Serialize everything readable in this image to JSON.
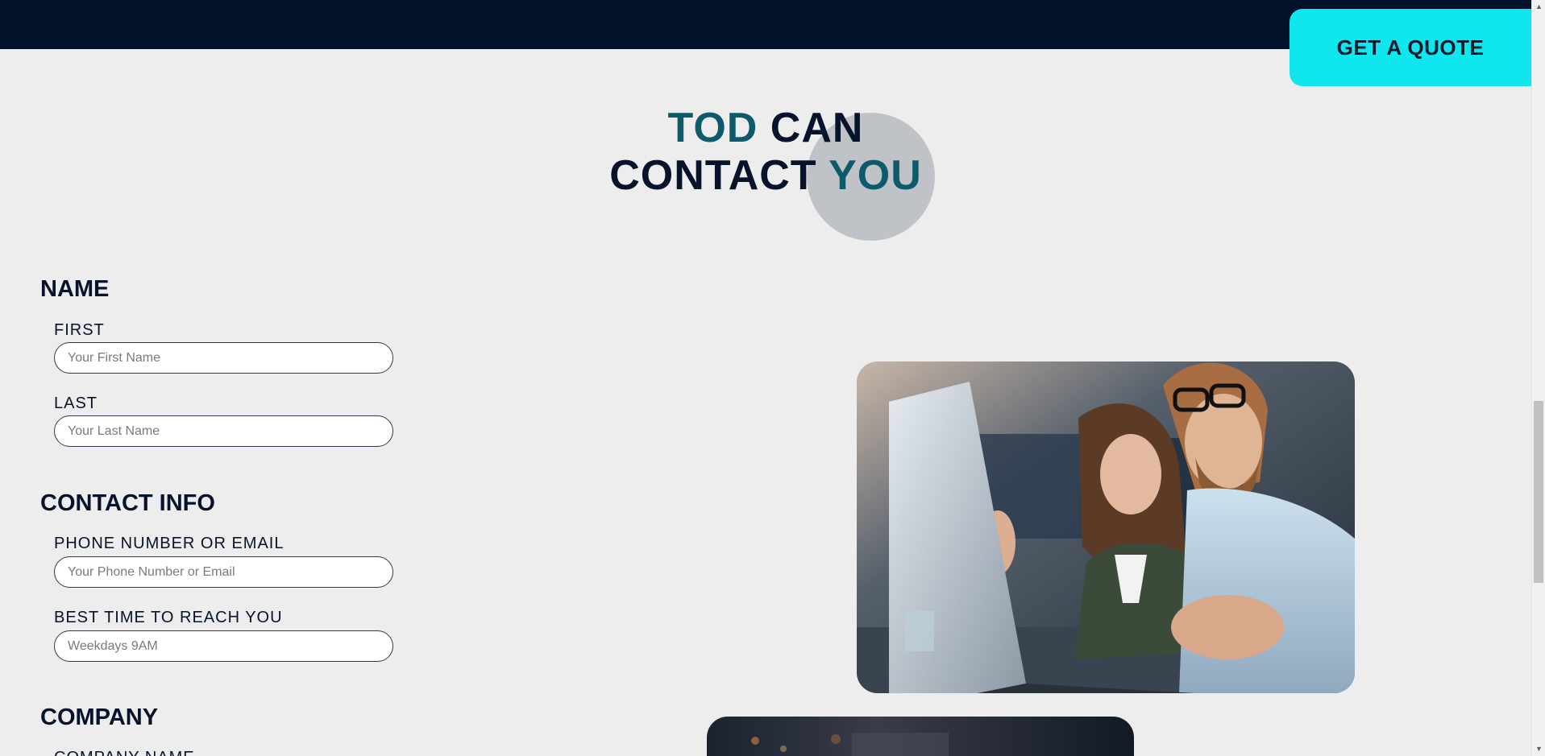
{
  "header": {
    "cta_label": "GET A QUOTE"
  },
  "hero": {
    "title_part1": "TOD",
    "title_part2": "CAN",
    "title_part3": "CONTACT",
    "title_part4": "YOU"
  },
  "form": {
    "name_section": {
      "title": "NAME",
      "first_label": "FIRST",
      "first_placeholder": "Your First Name",
      "last_label": "LAST",
      "last_placeholder": "Your Last Name"
    },
    "contact_section": {
      "title": "CONTACT INFO",
      "phone_label": "PHONE NUMBER OR EMAIL",
      "phone_placeholder": "Your Phone Number or Email",
      "time_label": "BEST TIME TO REACH YOU",
      "time_placeholder": "Weekdays 9AM"
    },
    "company_section": {
      "title": "COMPANY",
      "company_label": "COMPANY NAME"
    }
  },
  "colors": {
    "nav_background": "#02122a",
    "cta_background": "#10e6ee",
    "heading_teal": "#0d5a6a",
    "heading_navy": "#06132a",
    "page_background": "#ededed"
  },
  "icons": {
    "scroll_up": "scroll-up-arrow-icon",
    "scroll_down": "scroll-down-arrow-icon"
  }
}
